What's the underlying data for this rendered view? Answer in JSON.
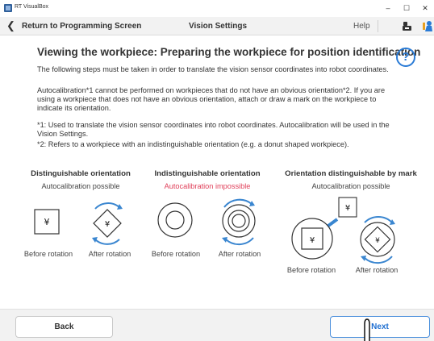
{
  "window": {
    "title": "RT VisualBox",
    "minimize": "–",
    "maximize": "☐",
    "close": "✕"
  },
  "header": {
    "back_chevron": "❮",
    "back_label": "Return to Programming Screen",
    "screen_title": "Vision Settings",
    "help_label": "Help",
    "icons": [
      "robot-icon",
      "person-icon"
    ]
  },
  "content": {
    "heading": "Viewing the workpiece: Preparing the workpiece for position identification",
    "help_icon_text": "?",
    "paragraph1": "The following steps must be taken in order to translate the vision sensor coordinates into robot coordinates.",
    "paragraph2": "Autocalibration*1 cannot be performed on workpieces that do not have an obvious orientation*2. If you are using a workpiece that does not have an obvious orientation, attach or draw a mark on the workpiece to indicate its orientation.",
    "note1": "*1: Used to translate the vision sensor coordinates into robot coordinates. Autocalibration will be used in the Vision Settings.",
    "note2": "*2: Refers to a workpiece with an indistinguishable orientation (e.g. a donut shaped workpiece)."
  },
  "columns": [
    {
      "title": "Distinguishable orientation",
      "status": "Autocalibration possible",
      "status_color": "#444444",
      "mark_glyph": "¥",
      "captions": [
        "Before rotation",
        "After rotation"
      ]
    },
    {
      "title": "Indistinguishable orientation",
      "status": "Autocalibration impossible",
      "status_color": "#e0405a",
      "captions": [
        "Before rotation",
        "After rotation"
      ]
    },
    {
      "title": "Orientation distinguishable by mark",
      "status": "Autocalibration possible",
      "status_color": "#444444",
      "mark_glyph": "¥",
      "captions": [
        "Before rotation",
        "After rotation"
      ]
    }
  ],
  "footer": {
    "back_button": "Back",
    "next_button": "Next"
  },
  "colors": {
    "accent": "#2a7bd6",
    "arrow_blue": "#3a86d0",
    "impossible_red": "#e0405a"
  }
}
